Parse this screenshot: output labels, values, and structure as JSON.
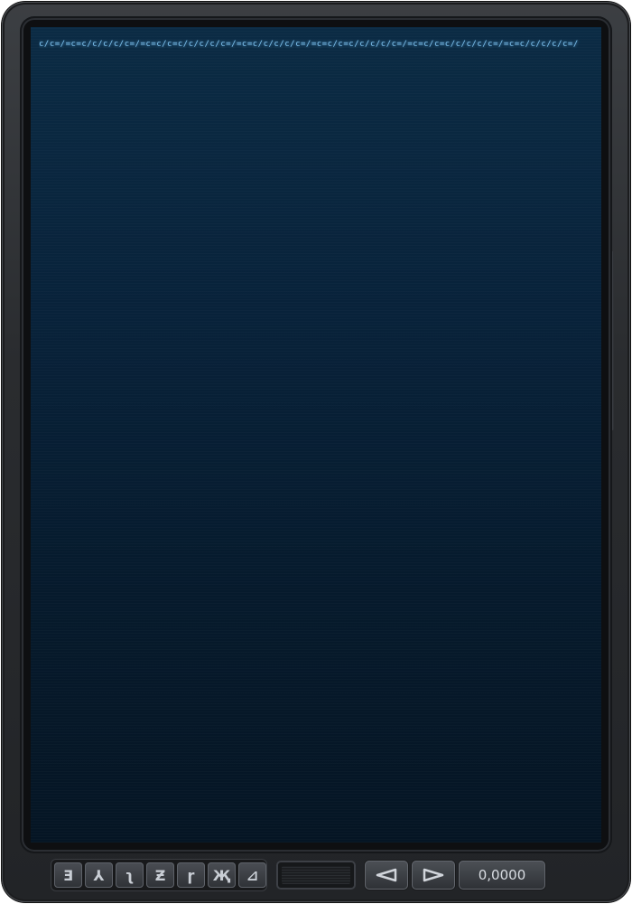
{
  "screen": {
    "header_glyph_text": "c/c=/=c=c/c/c/c/c=/=c=c/c=c/c/c/c/c=/=c=c/c/c/c/c=/=c=c/c=c/c/c/c/c=/=c=c/c=c/c/c/c/c=/=c=c/c/c/c/c=/"
  },
  "toolbar": {
    "glyph_buttons": [
      {
        "glyph": "Ǝ",
        "icon": "glyph-1-icon"
      },
      {
        "glyph": "⅄",
        "icon": "glyph-2-icon"
      },
      {
        "glyph": "ʅ",
        "icon": "glyph-3-icon"
      },
      {
        "glyph": "Ƶ",
        "icon": "glyph-4-icon"
      },
      {
        "glyph": "ɼ",
        "icon": "glyph-5-icon"
      },
      {
        "glyph": "Җ",
        "icon": "glyph-6-icon"
      },
      {
        "glyph": "⊿",
        "icon": "glyph-7-icon"
      }
    ],
    "prev_icon": "triangle-left-icon",
    "next_icon": "triangle-right-icon",
    "counter_text": "0,0000"
  },
  "colors": {
    "screen_glow": "#7fc4f0",
    "frame": "#2a2c2f",
    "screen_bg": "#08223a"
  }
}
